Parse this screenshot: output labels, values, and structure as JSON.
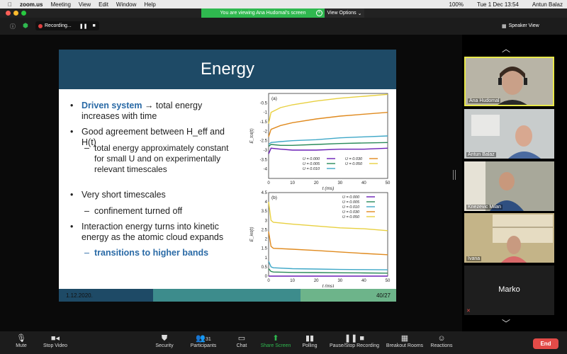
{
  "menubar": {
    "app": "zoom.us",
    "items": [
      "Meeting",
      "View",
      "Edit",
      "Window",
      "Help"
    ],
    "battery": "100%",
    "datetime": "Tue 1 Dec  13:54",
    "user": "Antun Balaz"
  },
  "banner": {
    "text": "You are viewing Ana Hudomal's screen",
    "view_options": "View Options"
  },
  "recording": {
    "label": "Recording..."
  },
  "speaker_view": "Speaker View",
  "slide": {
    "title": "Energy",
    "bullets": [
      {
        "hl": "Driven system",
        "rest": " → total energy increases with time"
      },
      {
        "text": "Good agreement between H_eff and H(t)"
      },
      {
        "text": "total energy approximately constant for small U and on experimentally relevant timescales"
      },
      {
        "text": "Very short timescales"
      },
      {
        "text": "confinement turned off"
      },
      {
        "text": "Interaction energy turns into kinetic energy as the atomic cloud expands"
      },
      {
        "hl": "transitions to higher bands"
      }
    ],
    "footer_date": "1.12.2020.",
    "footer_page": "40/27"
  },
  "chart_data": [
    {
      "type": "line",
      "panel": "(a)",
      "xlabel": "t (ms)",
      "ylabel": "E_tot(t)",
      "xlim": [
        0,
        50
      ],
      "ylim": [
        -4.5,
        0
      ],
      "xticks": [
        0,
        10,
        20,
        30,
        40,
        50
      ],
      "yticks": [
        -0.5,
        -1,
        -1.5,
        -2,
        -2.5,
        -3,
        -3.5,
        -4
      ],
      "series": [
        {
          "name": "U = 0.000",
          "color": "#6a1fb5",
          "x": [
            0,
            1,
            5,
            10,
            20,
            30,
            40,
            50
          ],
          "y": [
            -3.2,
            -2.9,
            -2.95,
            -3.0,
            -3.0,
            -2.95,
            -2.95,
            -2.9
          ]
        },
        {
          "name": "U = 0.005",
          "color": "#2a8a5a",
          "x": [
            0,
            1,
            5,
            10,
            20,
            30,
            40,
            50
          ],
          "y": [
            -2.8,
            -2.7,
            -2.75,
            -2.75,
            -2.7,
            -2.65,
            -2.62,
            -2.6
          ]
        },
        {
          "name": "U = 0.010",
          "color": "#3fa8c8",
          "x": [
            0,
            1,
            5,
            10,
            20,
            30,
            40,
            50
          ],
          "y": [
            -2.7,
            -2.6,
            -2.55,
            -2.5,
            -2.45,
            -2.35,
            -2.3,
            -2.25
          ]
        },
        {
          "name": "U = 0.030",
          "color": "#e08a1e",
          "x": [
            0,
            1,
            5,
            10,
            20,
            30,
            40,
            50
          ],
          "y": [
            -2.3,
            -1.9,
            -1.7,
            -1.55,
            -1.35,
            -1.2,
            -1.1,
            -1.0
          ]
        },
        {
          "name": "U = 0.050",
          "color": "#e8d040",
          "x": [
            0,
            1,
            5,
            10,
            20,
            30,
            40,
            50
          ],
          "y": [
            -1.6,
            -1.0,
            -0.75,
            -0.6,
            -0.4,
            -0.25,
            -0.15,
            -0.05
          ]
        }
      ]
    },
    {
      "type": "line",
      "panel": "(b)",
      "xlabel": "t (ms)",
      "ylabel": "E_int(t)",
      "xlim": [
        0,
        50
      ],
      "ylim": [
        0,
        4.5
      ],
      "xticks": [
        0,
        10,
        20,
        30,
        40,
        50
      ],
      "yticks": [
        0,
        0.5,
        1,
        1.5,
        2,
        2.5,
        3,
        3.5,
        4,
        4.5
      ],
      "series": [
        {
          "name": "U = 0.000",
          "color": "#6a1fb5",
          "x": [
            0,
            1,
            2,
            10,
            20,
            30,
            40,
            50
          ],
          "y": [
            0,
            0,
            0,
            0,
            0,
            0,
            0,
            0
          ]
        },
        {
          "name": "U = 0.005",
          "color": "#2a8a5a",
          "x": [
            0,
            1,
            2,
            10,
            20,
            30,
            40,
            50
          ],
          "y": [
            0.4,
            0.25,
            0.22,
            0.2,
            0.19,
            0.18,
            0.17,
            0.16
          ]
        },
        {
          "name": "U = 0.010",
          "color": "#3fa8c8",
          "x": [
            0,
            1,
            2,
            10,
            20,
            30,
            40,
            50
          ],
          "y": [
            0.8,
            0.5,
            0.45,
            0.4,
            0.38,
            0.36,
            0.35,
            0.34
          ]
        },
        {
          "name": "U = 0.030",
          "color": "#e08a1e",
          "x": [
            0,
            1,
            2,
            10,
            20,
            30,
            40,
            50
          ],
          "y": [
            2.4,
            1.6,
            1.5,
            1.45,
            1.38,
            1.3,
            1.22,
            1.15
          ]
        },
        {
          "name": "U = 0.050",
          "color": "#e8d040",
          "x": [
            0,
            1,
            2,
            10,
            20,
            30,
            40,
            50
          ],
          "y": [
            4.0,
            3.0,
            2.9,
            2.8,
            2.7,
            2.6,
            2.55,
            2.45
          ]
        }
      ]
    }
  ],
  "participants": [
    {
      "name": "Ana Hudomal",
      "active": true
    },
    {
      "name": "Antun Balaz"
    },
    {
      "name": "Knezevic Milan"
    },
    {
      "name": "Ivana"
    },
    {
      "name": "Marko"
    }
  ],
  "toolbar": {
    "mute": "Mute",
    "stop_video": "Stop Video",
    "security": "Security",
    "participants": "Participants",
    "participants_count": "31",
    "chat": "Chat",
    "share_screen": "Share Screen",
    "polling": "Polling",
    "record": "Pause/Stop Recording",
    "breakout": "Breakout Rooms",
    "reactions": "Reactions",
    "end": "End"
  }
}
